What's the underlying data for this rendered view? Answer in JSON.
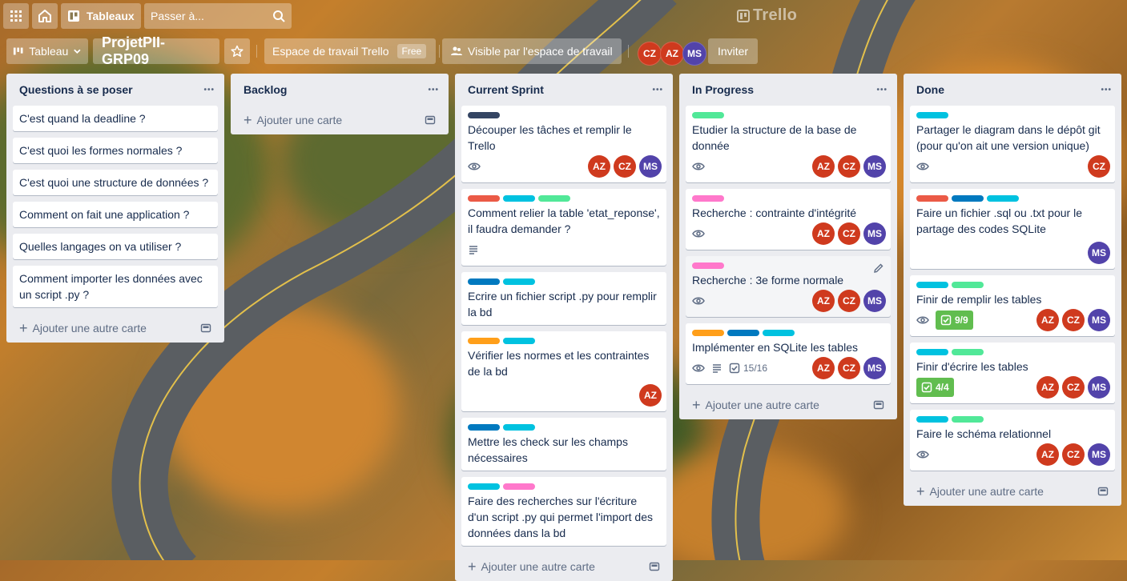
{
  "topbar": {
    "boards_label": "Tableaux",
    "search_placeholder": "Passer à...",
    "logo_text": "Trello"
  },
  "board_header": {
    "view_label": "Tableau",
    "board_name": "ProjetPII-GRP09",
    "workspace_label": "Espace de travail Trello",
    "workspace_plan": "Free",
    "visibility_label": "Visible par l'espace de travail",
    "members": [
      {
        "initials": "CZ",
        "color": "#cf3a1e"
      },
      {
        "initials": "AZ",
        "color": "#cf3a1e"
      },
      {
        "initials": "MS",
        "color": "#5243aa"
      }
    ],
    "invite_label": "Inviter"
  },
  "colors": {
    "green": "#61bd4f",
    "sky": "#00c2e0",
    "lime": "#51e898",
    "navy": "#344563",
    "blue": "#0079bf",
    "red": "#eb5a46",
    "pink": "#ff78cb",
    "orange": "#ff9f1a"
  },
  "lists": [
    {
      "title": "Questions à se poser",
      "cards": [
        {
          "title": "C'est quand la deadline ?"
        },
        {
          "title": "C'est quoi les formes normales ?"
        },
        {
          "title": "C'est quoi une structure de données ?"
        },
        {
          "title": "Comment on fait une application ?"
        },
        {
          "title": "Quelles langages on va utiliser ?"
        },
        {
          "title": "Comment importer les données avec un script .py ?"
        }
      ],
      "add_label": "Ajouter une autre carte"
    },
    {
      "title": "Backlog",
      "cards": [],
      "add_label": "Ajouter une carte"
    },
    {
      "title": "Current Sprint",
      "cards": [
        {
          "title": "Découper les tâches et remplir le Trello",
          "labels": [
            "navy"
          ],
          "watch": true,
          "members": [
            "AZ",
            "CZ",
            "MS"
          ]
        },
        {
          "title": "Comment relier la table 'etat_reponse', il faudra demander ?",
          "labels": [
            "red",
            "sky",
            "lime"
          ],
          "description": true
        },
        {
          "title": "Ecrire un fichier script .py pour remplir la bd",
          "labels": [
            "blue",
            "sky"
          ]
        },
        {
          "title": "Vérifier les normes et les contraintes de la bd",
          "labels": [
            "orange",
            "sky"
          ],
          "members": [
            "AZ"
          ]
        },
        {
          "title": "Mettre les check sur les champs nécessaires",
          "labels": [
            "blue",
            "sky"
          ]
        },
        {
          "title": "Faire des recherches sur l'écriture d'un script .py qui permet l'import des données dans la bd",
          "labels": [
            "sky",
            "pink"
          ]
        }
      ],
      "add_label": "Ajouter une autre carte"
    },
    {
      "title": "In Progress",
      "cards": [
        {
          "title": "Etudier la structure de la base de donnée",
          "labels": [
            "lime"
          ],
          "watch": true,
          "members": [
            "AZ",
            "CZ",
            "MS"
          ]
        },
        {
          "title": "Recherche : contrainte d'intégrité",
          "labels": [
            "pink"
          ],
          "watch": true,
          "members": [
            "AZ",
            "CZ",
            "MS"
          ]
        },
        {
          "title": "Recherche : 3e forme normale",
          "labels": [
            "pink"
          ],
          "watch": true,
          "members": [
            "AZ",
            "CZ",
            "MS"
          ],
          "hover": true
        },
        {
          "title": "Implémenter en SQLite les tables",
          "labels": [
            "orange",
            "blue",
            "sky"
          ],
          "watch": true,
          "description": true,
          "checklist": "15/16",
          "members": [
            "AZ",
            "CZ",
            "MS"
          ]
        }
      ],
      "add_label": "Ajouter une autre carte"
    },
    {
      "title": "Done",
      "cards": [
        {
          "title": "Partager le diagram dans le dépôt git (pour qu'on ait une version unique)",
          "labels": [
            "sky"
          ],
          "watch": true,
          "members": [
            "CZ"
          ]
        },
        {
          "title": "Faire un fichier .sql ou .txt pour le partage des codes SQLite",
          "labels": [
            "red",
            "blue",
            "sky"
          ],
          "members": [
            "MS"
          ]
        },
        {
          "title": "Finir de remplir les tables",
          "labels": [
            "sky",
            "lime"
          ],
          "watch": true,
          "checklist_done": "9/9",
          "members": [
            "AZ",
            "CZ",
            "MS"
          ]
        },
        {
          "title": "Finir d'écrire les tables",
          "labels": [
            "sky",
            "lime"
          ],
          "checklist_done": "4/4",
          "members": [
            "AZ",
            "CZ",
            "MS"
          ]
        },
        {
          "title": "Faire le schéma relationnel",
          "labels": [
            "sky",
            "lime"
          ],
          "watch": true,
          "members": [
            "AZ",
            "CZ",
            "MS"
          ]
        }
      ],
      "add_label": "Ajouter une autre carte"
    }
  ]
}
